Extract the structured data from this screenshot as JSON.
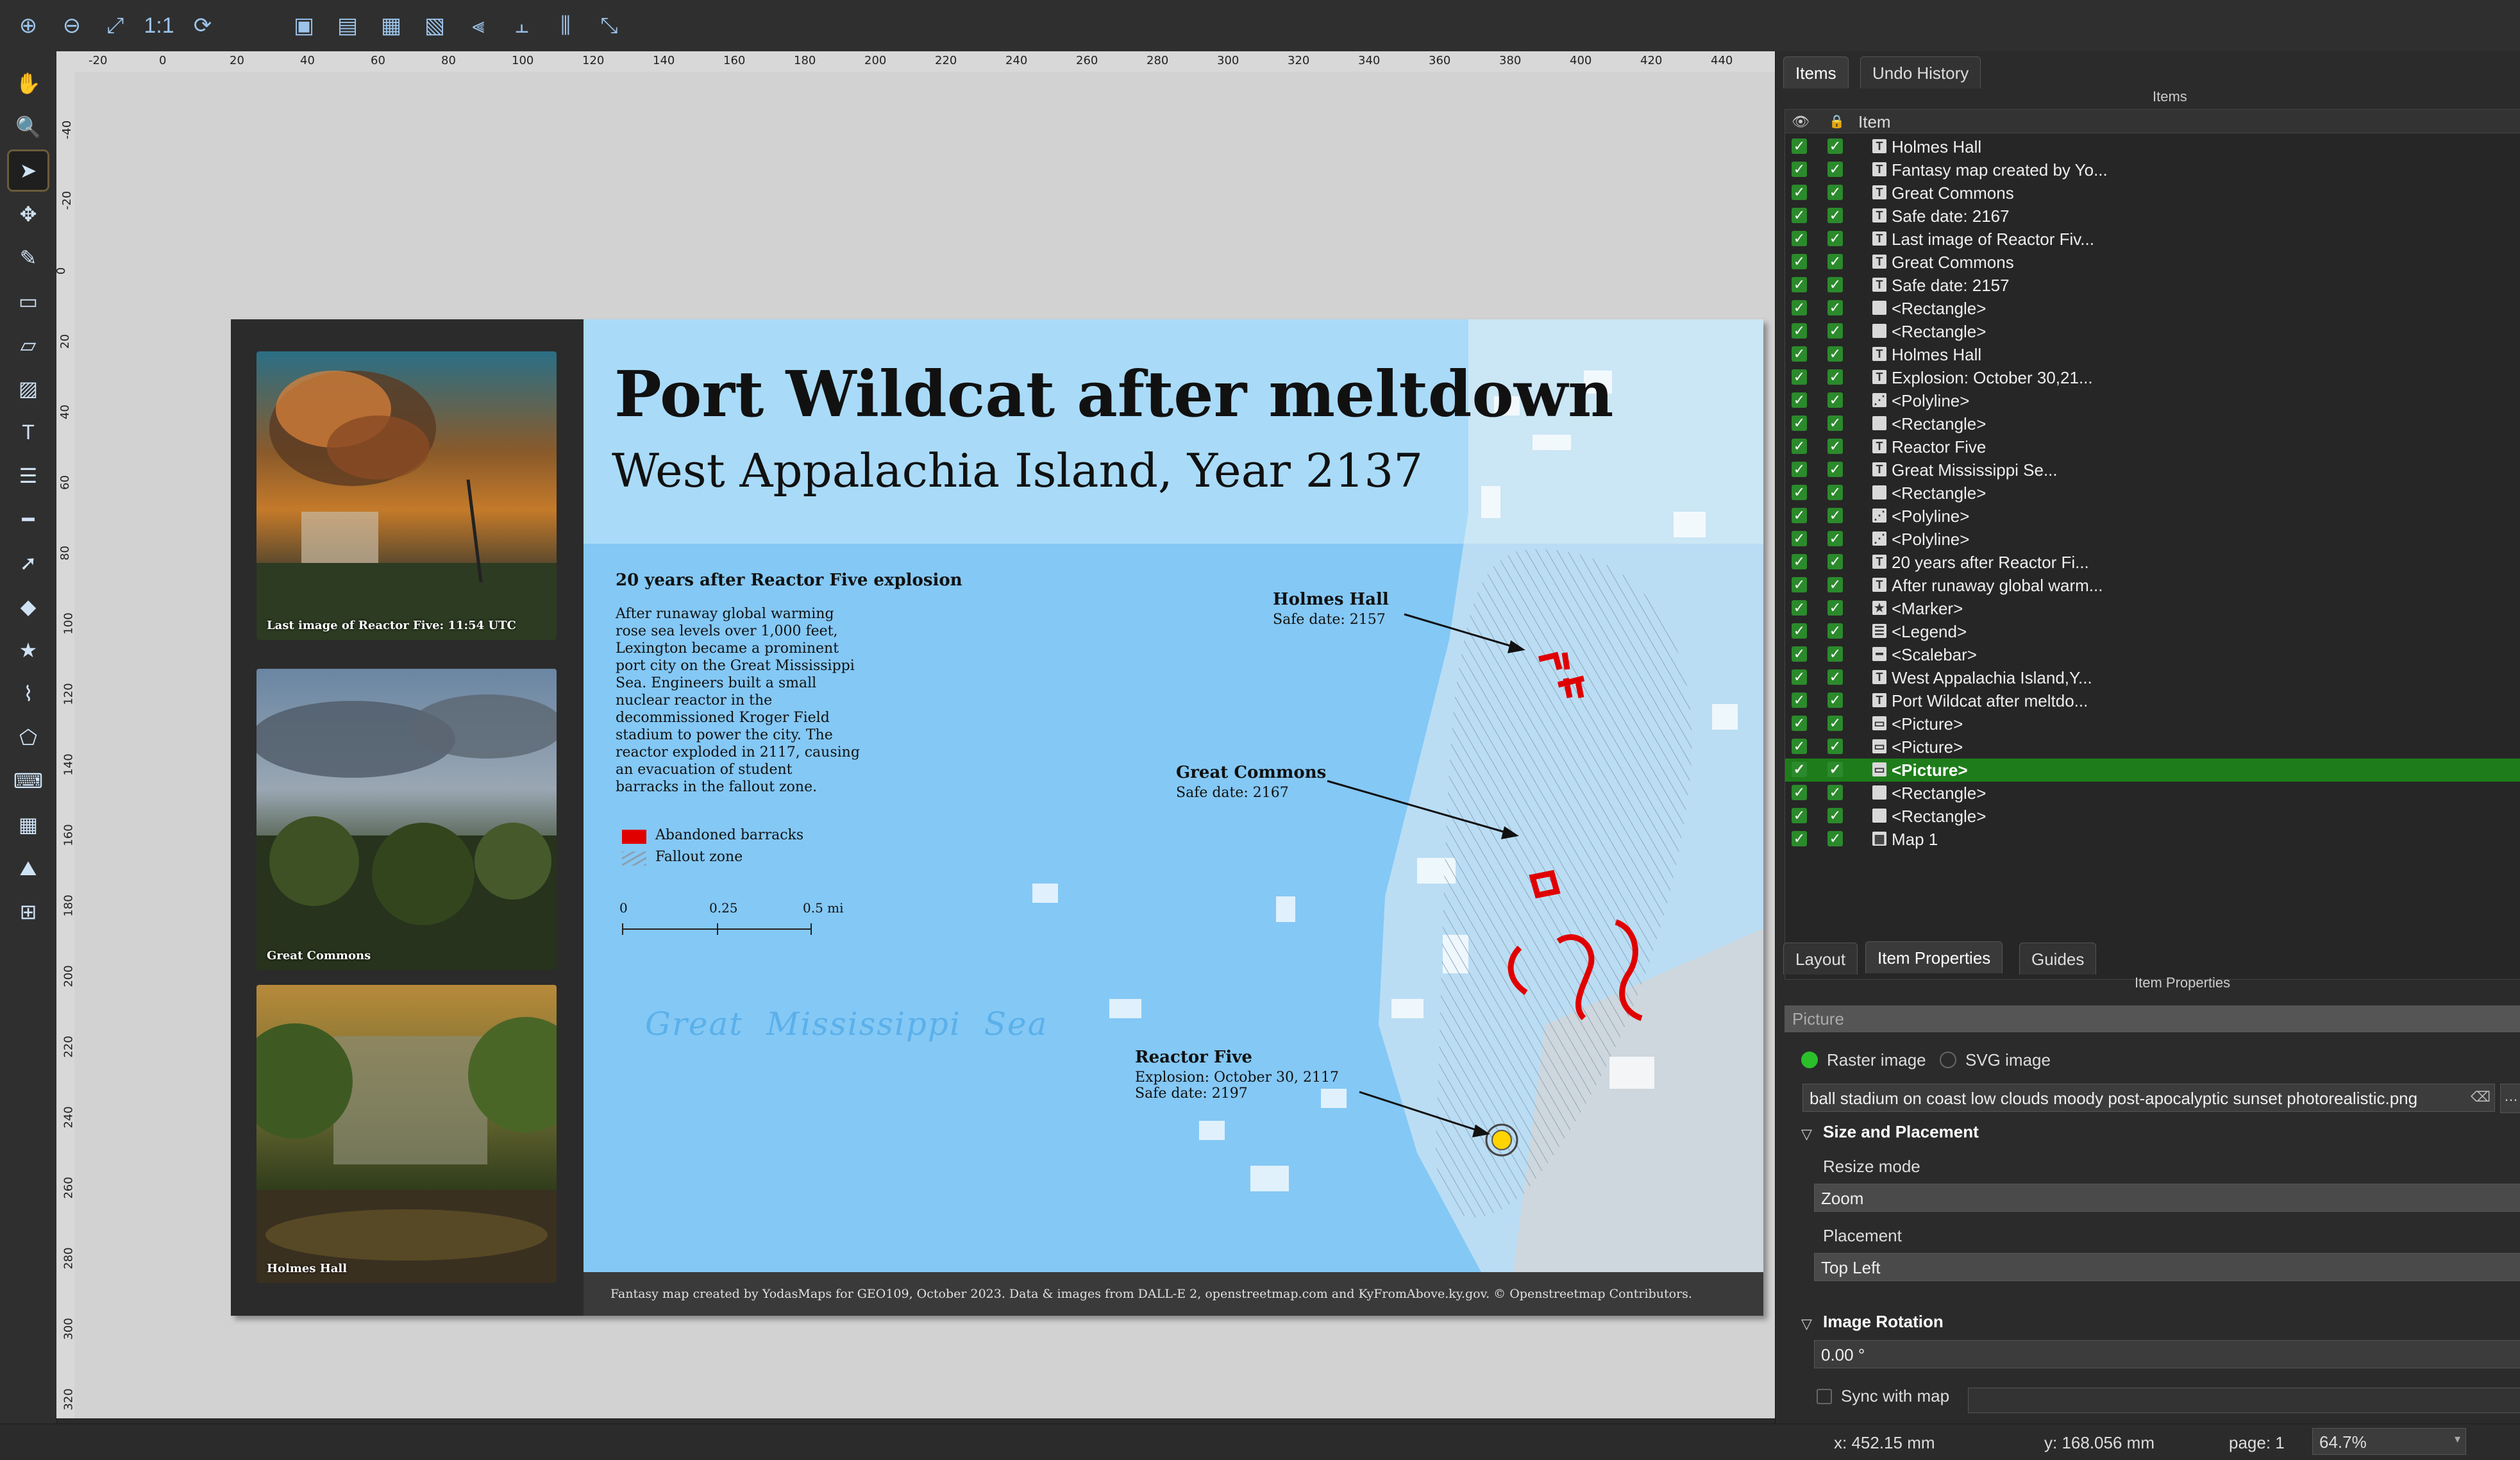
{
  "top_toolbar": {
    "icons": [
      "zoom-in-icon",
      "zoom-out-icon",
      "zoom-full-icon",
      "zoom-actual-icon",
      "refresh-icon",
      "raise-icon",
      "lower-icon",
      "group-icon",
      "ungroup-icon",
      "align-left-icon",
      "align-top-icon",
      "distribute-icon",
      "resize-icon"
    ]
  },
  "left_toolbar": {
    "icons": [
      "pan-icon",
      "zoom-icon",
      "select-icon",
      "move-content-icon",
      "edit-nodes-icon",
      "add-map-icon",
      "add-3d-map-icon",
      "add-picture-icon",
      "add-label-icon",
      "add-legend-icon",
      "add-scalebar-icon",
      "add-north-arrow-icon",
      "add-shape-icon",
      "add-marker-icon",
      "add-polyline-icon",
      "add-polygon-icon",
      "add-html-icon",
      "add-table-icon",
      "add-elevation-icon",
      "add-text-table-icon"
    ],
    "active_index": 2
  },
  "rulers": {
    "horizontal_ticks": [
      "-20",
      "0",
      "20",
      "40",
      "60",
      "80",
      "100",
      "120",
      "140",
      "160",
      "180",
      "200",
      "220",
      "240",
      "260",
      "280",
      "300",
      "320",
      "340",
      "360",
      "380",
      "400",
      "420",
      "440"
    ],
    "vertical_ticks": [
      "-40",
      "-20",
      "0",
      "20",
      "40",
      "60",
      "80",
      "100",
      "120",
      "140",
      "160",
      "180",
      "200",
      "220",
      "240",
      "260",
      "280",
      "300",
      "320"
    ]
  },
  "layout": {
    "title": "Port Wildcat after meltdown",
    "subtitle": "West Appalachia Island, Year  2137",
    "intro_heading": "20 years after Reactor Five explosion",
    "intro_lines": [
      "After runaway global warming",
      "rose sea levels over 1,000 feet,",
      "Lexington became a prominent",
      "port city on the Great Mississippi",
      "Sea. Engineers built a small",
      "nuclear reactor in the",
      "decommissioned Kroger Field",
      "stadium to power the city. The",
      "reactor exploded in 2117, causing",
      "an evacuation of student",
      "barracks in the fallout zone."
    ],
    "legend": [
      {
        "label": "Abandoned barracks",
        "color": "#e00000"
      },
      {
        "label": "Fallout zone",
        "color": "#b8c6d4"
      }
    ],
    "scalebar": {
      "labels": [
        "0",
        "0.25",
        "0.5 mi"
      ]
    },
    "sea_label": "Great  Mississippi  Sea",
    "annotations": [
      {
        "title": "Holmes Hall",
        "lines": [
          "Safe date: 2157"
        ]
      },
      {
        "title": "Great Commons",
        "lines": [
          "Safe date: 2167"
        ]
      },
      {
        "title": "Reactor Five",
        "lines": [
          "Explosion: October 30, 2117",
          "Safe date: 2197"
        ]
      }
    ],
    "photos": [
      {
        "caption": "Last image of Reactor Five: 11:54 UTC"
      },
      {
        "caption": "Great Commons"
      },
      {
        "caption": "Holmes Hall"
      }
    ],
    "footer": "Fantasy map created by YodasMaps for GEO109, October 2023.  Data & images from DALL-E 2, openstreetmap.com and KyFromAbove.ky.gov.  © Openstreetmap Contributors.",
    "colors": {
      "sea": "#84c8f5",
      "title_band": "#a9dbf8",
      "barracks": "#e00000",
      "marker": "#ffd400"
    }
  },
  "right_panel": {
    "tabs": [
      "Items",
      "Undo History"
    ],
    "items_title": "Items",
    "column_header": "Item",
    "items": [
      {
        "name": "Holmes Hall",
        "type": "T"
      },
      {
        "name": "Fantasy map created by Yo...",
        "type": "T"
      },
      {
        "name": "Great Commons",
        "type": "T"
      },
      {
        "name": "Safe date: 2167",
        "type": "T"
      },
      {
        "name": "Last image of Reactor Fiv...",
        "type": "T"
      },
      {
        "name": "Great Commons",
        "type": "T"
      },
      {
        "name": "Safe date: 2157",
        "type": "T"
      },
      {
        "name": "<Rectangle>",
        "type": " "
      },
      {
        "name": "<Rectangle>",
        "type": " "
      },
      {
        "name": "Holmes Hall",
        "type": "T"
      },
      {
        "name": "Explosion: October 30,21...",
        "type": "T"
      },
      {
        "name": "<Polyline>",
        "type": "⋰"
      },
      {
        "name": "<Rectangle>",
        "type": " "
      },
      {
        "name": "Reactor Five",
        "type": "T"
      },
      {
        "name": "Great Mississippi Se...",
        "type": "T"
      },
      {
        "name": "<Rectangle>",
        "type": " "
      },
      {
        "name": "<Polyline>",
        "type": "⋰"
      },
      {
        "name": "<Polyline>",
        "type": "⋰"
      },
      {
        "name": "20 years after Reactor Fi...",
        "type": "T"
      },
      {
        "name": "After runaway global warm...",
        "type": "T"
      },
      {
        "name": "<Marker>",
        "type": "★"
      },
      {
        "name": "<Legend>",
        "type": "☰"
      },
      {
        "name": "<Scalebar>",
        "type": "━"
      },
      {
        "name": "West Appalachia Island,Y...",
        "type": "T"
      },
      {
        "name": "Port Wildcat after meltdo...",
        "type": "T"
      },
      {
        "name": "<Picture>",
        "type": "▭"
      },
      {
        "name": "<Picture>",
        "type": "▭"
      },
      {
        "name": "<Picture>",
        "type": "▭",
        "selected": true
      },
      {
        "name": "<Rectangle>",
        "type": " "
      },
      {
        "name": "<Rectangle>",
        "type": " "
      },
      {
        "name": "Map 1",
        "type": "▦"
      }
    ],
    "bottom_tabs": [
      "Layout",
      "Item Properties",
      "Guides"
    ],
    "props_title": "Item Properties",
    "section": "Picture",
    "raster_label": "Raster image",
    "svg_label": "SVG image",
    "file_path": "ball stadium on coast low clouds moody post-apocalyptic sunset photorealistic.png",
    "size_placement": "Size and Placement",
    "resize_mode_label": "Resize mode",
    "resize_mode": "Zoom",
    "placement_label": "Placement",
    "placement": "Top Left",
    "image_rotation": "Image Rotation",
    "rotation_value": "0.00 °",
    "sync_label": "Sync with map"
  },
  "status_bar": {
    "x": "x: 452.15 mm",
    "y": "y: 168.056 mm",
    "page": "page: 1",
    "zoom": "64.7%"
  }
}
